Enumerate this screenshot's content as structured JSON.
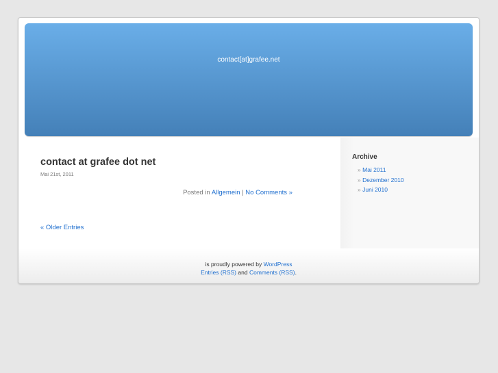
{
  "header": {
    "description": "contact[at]grafee.net"
  },
  "post": {
    "title": "contact at grafee dot net",
    "date": "Mai 21st, 2011",
    "posted_in": "Posted in",
    "category": "Allgemein",
    "separator": "|",
    "comments": "No Comments »"
  },
  "navigation": {
    "older": "« Older Entries"
  },
  "sidebar": {
    "heading": "Archive",
    "bullet": "»",
    "items": [
      {
        "label": "Mai 2011"
      },
      {
        "label": "Dezember 2010"
      },
      {
        "label": "Juni 2010"
      }
    ]
  },
  "footer": {
    "powered": "is proudly powered by",
    "wordpress": "WordPress",
    "entries": "Entries (RSS)",
    "and": "and",
    "comments": "Comments (RSS)",
    "period": "."
  }
}
